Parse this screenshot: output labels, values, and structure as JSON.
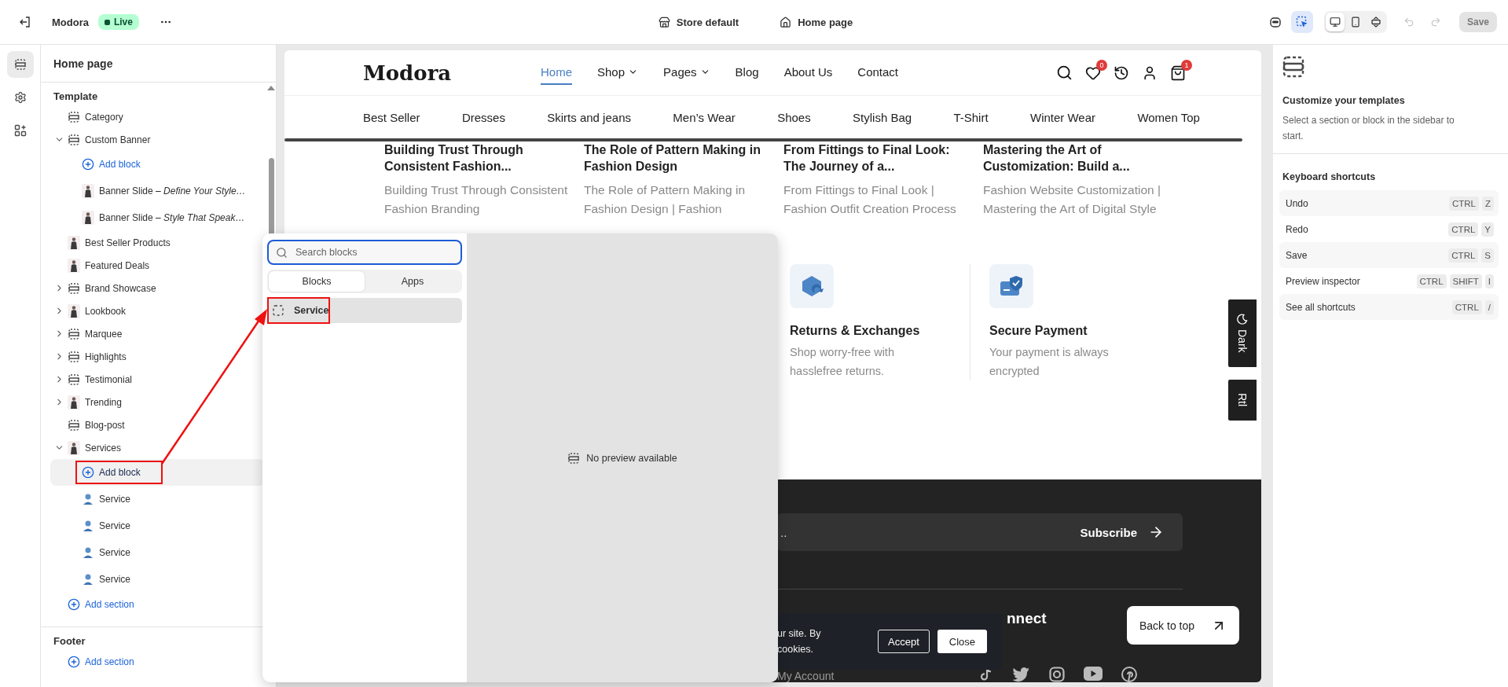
{
  "topbar": {
    "store_name": "Modora",
    "status": "Live",
    "theme": "Store default",
    "page": "Home page",
    "inspector_on": true,
    "devices": [
      {
        "kind": "desktop",
        "selected": true
      },
      {
        "kind": "mobile",
        "selected": false
      },
      {
        "kind": "fit",
        "selected": false
      }
    ],
    "undo_disabled": true,
    "redo_disabled": true,
    "save": {
      "label": "Save",
      "disabled": true
    }
  },
  "rail": [
    {
      "kind": "sections",
      "selected": true
    },
    {
      "kind": "settings",
      "selected": false
    },
    {
      "kind": "apps",
      "selected": false
    }
  ],
  "sidebar": {
    "title": "Home page",
    "groups": [
      {
        "label": "Template",
        "items": [
          {
            "kind": "section",
            "label": "Category",
            "selected": false
          },
          {
            "kind": "section",
            "label": "Custom Banner",
            "expanded": true,
            "selected": false,
            "children": [
              {
                "kind": "add",
                "label": "Add block",
                "selected": false
              },
              {
                "kind": "photo",
                "label": "Banner Slide *– Define Your Style…*",
                "selected": false
              },
              {
                "kind": "photo",
                "label": "Banner Slide *– Style That Speak…*",
                "selected": false
              }
            ]
          },
          {
            "kind": "photo",
            "label": "Best Seller Products",
            "selected": false
          },
          {
            "kind": "photo",
            "label": "Featured Deals",
            "selected": false
          },
          {
            "kind": "section",
            "label": "Brand Showcase",
            "expanded": false,
            "selected": false
          },
          {
            "kind": "photo",
            "label": "Lookbook",
            "expanded": false,
            "selected": false
          },
          {
            "kind": "section",
            "label": "Marquee",
            "expanded": false,
            "selected": false
          },
          {
            "kind": "section",
            "label": "Highlights",
            "expanded": false,
            "selected": false
          },
          {
            "kind": "section",
            "label": "Testimonial",
            "expanded": false,
            "selected": false
          },
          {
            "kind": "photo",
            "label": "Trending",
            "expanded": false,
            "selected": false
          },
          {
            "kind": "section",
            "label": "Blog-post",
            "selected": false
          },
          {
            "kind": "photo",
            "label": "Services",
            "expanded": true,
            "selected": false,
            "children": [
              {
                "kind": "add",
                "label": "Add block",
                "selected": true,
                "marked": true
              },
              {
                "kind": "service",
                "label": "Service",
                "selected": false
              },
              {
                "kind": "service",
                "label": "Service",
                "selected": false
              },
              {
                "kind": "service",
                "label": "Service",
                "selected": false
              },
              {
                "kind": "service",
                "label": "Service",
                "selected": false
              }
            ]
          },
          {
            "kind": "add",
            "label": "Add section",
            "selected": false
          }
        ]
      },
      {
        "label": "Footer",
        "items": [
          {
            "kind": "add",
            "label": "Add section",
            "selected": false
          }
        ]
      }
    ]
  },
  "preview": {
    "logo": "Modora",
    "nav": [
      {
        "label": "Home",
        "selected": true,
        "dropdown": false
      },
      {
        "label": "Shop",
        "selected": false,
        "dropdown": true
      },
      {
        "label": "Pages",
        "selected": false,
        "dropdown": true
      },
      {
        "label": "Blog",
        "selected": false,
        "dropdown": false
      },
      {
        "label": "About Us",
        "selected": false,
        "dropdown": false
      },
      {
        "label": "Contact",
        "selected": false,
        "dropdown": false
      }
    ],
    "wishlist_count": "0",
    "cart_count": "1",
    "categories": [
      "Best Seller",
      "Dresses",
      "Skirts and jeans",
      "Men’s Wear",
      "Shoes",
      "Stylish Bag",
      "T-Shirt",
      "Winter Wear",
      "Women Top"
    ],
    "posts": [
      {
        "title": "Building Trust Through Consistent Fashion...",
        "excerpt": "Building Trust Through Consistent Fashion Branding"
      },
      {
        "title": "The Role of Pattern Making in Fashion Design",
        "excerpt": "The Role of Pattern Making in Fashion Design | Fashion"
      },
      {
        "title": "From Fittings to Final Look: The Journey of a...",
        "excerpt": "From Fittings to Final Look | Fashion Outfit Creation Process"
      },
      {
        "title": "Mastering the Art of Customization: Build a...",
        "excerpt": "Fashion Website Customization | Mastering the Art of Digital Style"
      }
    ],
    "services": [
      {
        "title": "Returns & Exchanges",
        "text": "Shop worry-free with hasslefree returns."
      },
      {
        "title": "Secure Payment",
        "text": "Your payment is always encrypted"
      }
    ],
    "newsletter": {
      "placeholder": "..",
      "button": "Subscribe"
    },
    "footer_link": "My Account",
    "footer_heading": "nnect",
    "cookie": {
      "lines": [
        "ur site. By",
        "cookies."
      ],
      "accept": "Accept",
      "close": "Close"
    },
    "back_to_top": "Back to top",
    "side_tabs": [
      "Dark",
      "Rtl"
    ]
  },
  "block_picker": {
    "search_placeholder": "Search blocks",
    "tabs": [
      {
        "label": "Blocks",
        "selected": true
      },
      {
        "label": "Apps",
        "selected": false
      }
    ],
    "items": [
      {
        "label": "Service",
        "selected": true,
        "marked": true
      }
    ],
    "preview_text": "No preview available"
  },
  "inspector": {
    "title": "Customize your templates",
    "text": "Select a section or block in the sidebar to start.",
    "shortcuts_title": "Keyboard shortcuts",
    "shortcuts": [
      {
        "label": "Undo",
        "keys": [
          "CTRL",
          "Z"
        ]
      },
      {
        "label": "Redo",
        "keys": [
          "CTRL",
          "Y"
        ]
      },
      {
        "label": "Save",
        "keys": [
          "CTRL",
          "S"
        ]
      },
      {
        "label": "Preview inspector",
        "keys": [
          "CTRL",
          "SHIFT",
          "I"
        ]
      },
      {
        "label": "See all shortcuts",
        "keys": [
          "CTRL",
          "/"
        ]
      }
    ]
  }
}
